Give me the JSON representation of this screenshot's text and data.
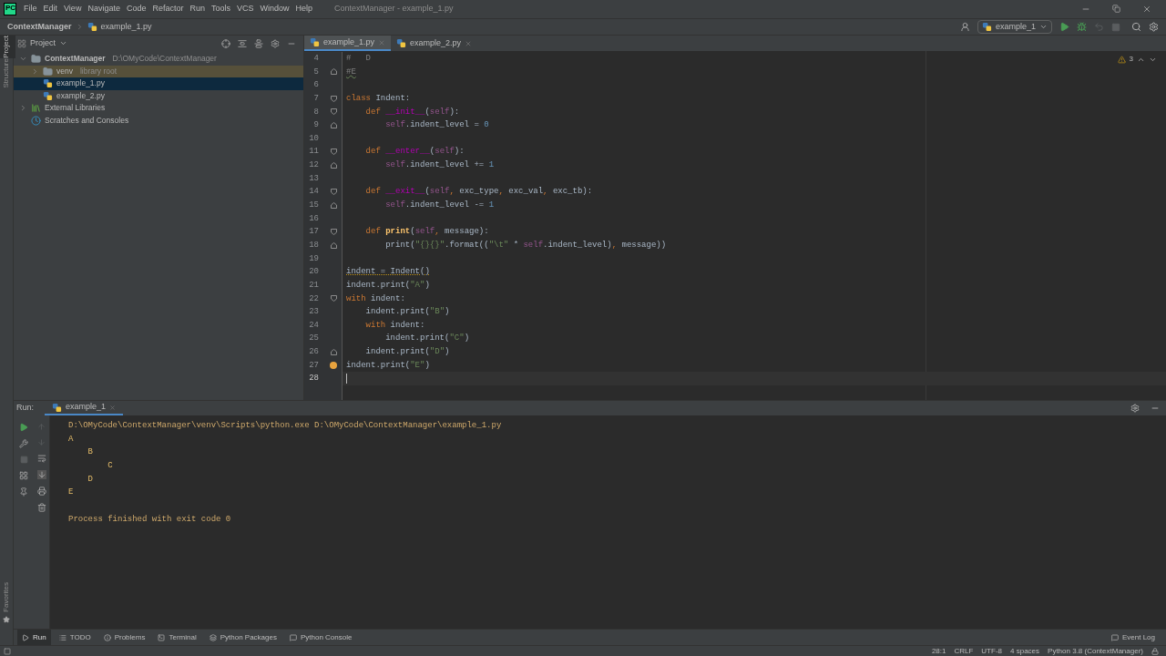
{
  "window": {
    "title": "ContextManager - example_1.py",
    "logo": "PC"
  },
  "menu": [
    "File",
    "Edit",
    "View",
    "Navigate",
    "Code",
    "Refactor",
    "Run",
    "Tools",
    "VCS",
    "Window",
    "Help"
  ],
  "breadcrumbs": [
    "ContextManager",
    "example_1.py"
  ],
  "run_config": "example_1",
  "side_tabs": [
    {
      "label": "Project",
      "selected": true
    },
    {
      "label": "Structure",
      "selected": false
    }
  ],
  "side_tabs_bottom": [
    {
      "label": "Favorites",
      "selected": false
    }
  ],
  "project": {
    "title": "Project",
    "tree": [
      {
        "kind": "folder",
        "label": "ContextManager",
        "hint": "D:\\OMyCode\\ContextManager",
        "expanded": true,
        "selected": false,
        "children": [
          {
            "kind": "folder",
            "label": "venv",
            "hint": "library root",
            "expanded": false,
            "selected": false,
            "excluded": true
          },
          {
            "kind": "file",
            "label": "example_1.py",
            "selected": true
          },
          {
            "kind": "file",
            "label": "example_2.py",
            "selected": false
          }
        ]
      },
      {
        "kind": "library",
        "label": "External Libraries",
        "expanded": false,
        "selected": false
      },
      {
        "kind": "scratches",
        "label": "Scratches and Consoles",
        "selected": false
      }
    ]
  },
  "editor": {
    "tabs": [
      {
        "label": "example_1.py",
        "selected": true
      },
      {
        "label": "example_2.py",
        "selected": false
      }
    ],
    "warnings": "3",
    "lines": [
      {
        "number": "4",
        "fold_start": false,
        "fold_end": false,
        "current": false,
        "tokens": [
          {
            "kind": "comment",
            "text": "#   D"
          }
        ]
      },
      {
        "number": "5",
        "fold_start": false,
        "fold_end": true,
        "current": false,
        "tokens": [
          {
            "kind": "comment-typo",
            "text": "#E"
          }
        ]
      },
      {
        "number": "6",
        "fold_start": false,
        "fold_end": false,
        "current": false
      },
      {
        "number": "7",
        "fold_start": true,
        "fold_end": false,
        "current": false,
        "tokens": [
          {
            "kind": "keyword",
            "text": "class "
          },
          {
            "kind": "plain",
            "text": "Indent:"
          }
        ]
      },
      {
        "number": "8",
        "fold_start": true,
        "fold_end": false,
        "current": false,
        "tokens": [
          {
            "kind": "keyword",
            "text": "    def "
          },
          {
            "kind": "dunder",
            "text": "__init__"
          },
          {
            "kind": "plain",
            "text": "("
          },
          {
            "kind": "self",
            "text": "self"
          },
          {
            "kind": "plain",
            "text": "):"
          }
        ]
      },
      {
        "number": "9",
        "fold_start": false,
        "fold_end": true,
        "current": false,
        "tokens": [
          {
            "kind": "self",
            "text": "        self"
          },
          {
            "kind": "plain",
            "text": ".indent_level = "
          },
          {
            "kind": "number",
            "text": "0"
          }
        ]
      },
      {
        "number": "10",
        "fold_start": false,
        "fold_end": false,
        "current": false
      },
      {
        "number": "11",
        "fold_start": true,
        "fold_end": false,
        "current": false,
        "tokens": [
          {
            "kind": "keyword",
            "text": "    def "
          },
          {
            "kind": "dunder",
            "text": "__enter__"
          },
          {
            "kind": "plain",
            "text": "("
          },
          {
            "kind": "self",
            "text": "self"
          },
          {
            "kind": "plain",
            "text": "):"
          }
        ]
      },
      {
        "number": "12",
        "fold_start": false,
        "fold_end": true,
        "current": false,
        "tokens": [
          {
            "kind": "self",
            "text": "        self"
          },
          {
            "kind": "plain",
            "text": ".indent_level += "
          },
          {
            "kind": "number",
            "text": "1"
          }
        ]
      },
      {
        "number": "13",
        "fold_start": false,
        "fold_end": false,
        "current": false
      },
      {
        "number": "14",
        "fold_start": true,
        "fold_end": false,
        "current": false,
        "tokens": [
          {
            "kind": "keyword",
            "text": "    def "
          },
          {
            "kind": "dunder",
            "text": "__exit__"
          },
          {
            "kind": "plain",
            "text": "("
          },
          {
            "kind": "self",
            "text": "self"
          },
          {
            "kind": "keyword",
            "text": ", "
          },
          {
            "kind": "plain",
            "text": "exc_type"
          },
          {
            "kind": "keyword",
            "text": ", "
          },
          {
            "kind": "plain",
            "text": "exc_val"
          },
          {
            "kind": "keyword",
            "text": ", "
          },
          {
            "kind": "plain",
            "text": "exc_tb):"
          }
        ]
      },
      {
        "number": "15",
        "fold_start": false,
        "fold_end": true,
        "current": false,
        "tokens": [
          {
            "kind": "self",
            "text": "        self"
          },
          {
            "kind": "plain",
            "text": ".indent_level -= "
          },
          {
            "kind": "number",
            "text": "1"
          }
        ]
      },
      {
        "number": "16",
        "fold_start": false,
        "fold_end": false,
        "current": false
      },
      {
        "number": "17",
        "fold_start": true,
        "fold_end": false,
        "current": false,
        "tokens": [
          {
            "kind": "keyword",
            "text": "    def "
          },
          {
            "kind": "function",
            "text": "print"
          },
          {
            "kind": "plain",
            "text": "("
          },
          {
            "kind": "self",
            "text": "self"
          },
          {
            "kind": "keyword",
            "text": ", "
          },
          {
            "kind": "plain",
            "text": "message):"
          }
        ]
      },
      {
        "number": "18",
        "fold_start": false,
        "fold_end": true,
        "current": false,
        "tokens": [
          {
            "kind": "plain",
            "text": "        print("
          },
          {
            "kind": "string",
            "text": "\"{}{}\""
          },
          {
            "kind": "plain",
            "text": ".format(("
          },
          {
            "kind": "string",
            "text": "\"\\t\""
          },
          {
            "kind": "plain",
            "text": " * "
          },
          {
            "kind": "self",
            "text": "self"
          },
          {
            "kind": "plain",
            "text": ".indent_level)"
          },
          {
            "kind": "keyword",
            "text": ", "
          },
          {
            "kind": "plain",
            "text": "message))"
          }
        ]
      },
      {
        "number": "19",
        "fold_start": false,
        "fold_end": false,
        "current": false
      },
      {
        "number": "20",
        "fold_start": false,
        "fold_end": false,
        "current": false,
        "tokens": [
          {
            "kind": "plain-warn",
            "text": "indent = Indent()"
          }
        ]
      },
      {
        "number": "21",
        "fold_start": false,
        "fold_end": false,
        "current": false,
        "tokens": [
          {
            "kind": "plain",
            "text": "indent.print("
          },
          {
            "kind": "string",
            "text": "\"A\""
          },
          {
            "kind": "plain",
            "text": ")"
          }
        ]
      },
      {
        "number": "22",
        "fold_start": true,
        "fold_end": false,
        "current": false,
        "tokens": [
          {
            "kind": "keyword",
            "text": "with "
          },
          {
            "kind": "plain",
            "text": "indent:"
          }
        ]
      },
      {
        "number": "23",
        "fold_start": false,
        "fold_end": false,
        "current": false,
        "tokens": [
          {
            "kind": "plain",
            "text": "    indent.print("
          },
          {
            "kind": "string",
            "text": "\"B\""
          },
          {
            "kind": "plain",
            "text": ")"
          }
        ]
      },
      {
        "number": "24",
        "fold_start": false,
        "fold_end": false,
        "current": false,
        "tokens": [
          {
            "kind": "keyword",
            "text": "    with "
          },
          {
            "kind": "plain",
            "text": "indent:"
          }
        ]
      },
      {
        "number": "25",
        "fold_start": false,
        "fold_end": false,
        "current": false,
        "tokens": [
          {
            "kind": "plain",
            "text": "        indent.print("
          },
          {
            "kind": "string",
            "text": "\"C\""
          },
          {
            "kind": "plain",
            "text": ")"
          }
        ]
      },
      {
        "number": "26",
        "fold_start": false,
        "fold_end": true,
        "current": false,
        "tokens": [
          {
            "kind": "plain",
            "text": "    indent.print("
          },
          {
            "kind": "string",
            "text": "\"D\""
          },
          {
            "kind": "plain",
            "text": ")"
          }
        ]
      },
      {
        "number": "27",
        "fold_start": false,
        "fold_end": false,
        "current": false,
        "bulb": true,
        "tokens": [
          {
            "kind": "plain",
            "text": "indent.print("
          },
          {
            "kind": "string",
            "text": "\"E\""
          },
          {
            "kind": "plain",
            "text": ")"
          }
        ]
      },
      {
        "number": "28",
        "fold_start": false,
        "fold_end": false,
        "current": true
      }
    ]
  },
  "run": {
    "label": "Run:",
    "tab": "example_1",
    "console": [
      {
        "kind": "command",
        "text": "D:\\OMyCode\\ContextManager\\venv\\Scripts\\python.exe D:\\OMyCode\\ContextManager\\example_1.py"
      },
      {
        "kind": "output",
        "text": "A"
      },
      {
        "kind": "output",
        "text": "\tB"
      },
      {
        "kind": "output",
        "text": "\t\tC"
      },
      {
        "kind": "output",
        "text": "\tD"
      },
      {
        "kind": "output",
        "text": "E"
      },
      {
        "kind": "blank"
      },
      {
        "kind": "system",
        "text": "Process finished with exit code 0"
      }
    ]
  },
  "tool_windows": [
    {
      "kind": "run",
      "label": "Run",
      "selected": true
    },
    {
      "kind": "todo",
      "label": "TODO",
      "selected": false
    },
    {
      "kind": "problems",
      "label": "Problems",
      "selected": false
    },
    {
      "kind": "terminal",
      "label": "Terminal",
      "selected": false
    },
    {
      "kind": "packages",
      "label": "Python Packages",
      "selected": false
    },
    {
      "kind": "console",
      "label": "Python Console",
      "selected": false
    }
  ],
  "event_log": "Event Log",
  "status_bar": [
    "28:1",
    "CRLF",
    "UTF-8",
    "4 spaces",
    "Python 3.8 (ContextManager)"
  ]
}
